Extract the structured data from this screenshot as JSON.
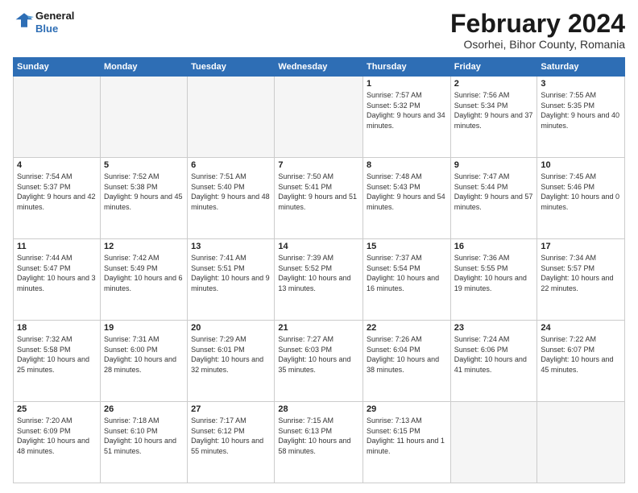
{
  "header": {
    "logo": {
      "line1": "General",
      "line2": "Blue"
    },
    "title": "February 2024",
    "location": "Osorhei, Bihor County, Romania"
  },
  "weekdays": [
    "Sunday",
    "Monday",
    "Tuesday",
    "Wednesday",
    "Thursday",
    "Friday",
    "Saturday"
  ],
  "weeks": [
    [
      {
        "day": "",
        "empty": true
      },
      {
        "day": "",
        "empty": true
      },
      {
        "day": "",
        "empty": true
      },
      {
        "day": "",
        "empty": true
      },
      {
        "day": "1",
        "sunrise": "7:57 AM",
        "sunset": "5:32 PM",
        "daylight": "9 hours and 34 minutes."
      },
      {
        "day": "2",
        "sunrise": "7:56 AM",
        "sunset": "5:34 PM",
        "daylight": "9 hours and 37 minutes."
      },
      {
        "day": "3",
        "sunrise": "7:55 AM",
        "sunset": "5:35 PM",
        "daylight": "9 hours and 40 minutes."
      }
    ],
    [
      {
        "day": "4",
        "sunrise": "7:54 AM",
        "sunset": "5:37 PM",
        "daylight": "9 hours and 42 minutes."
      },
      {
        "day": "5",
        "sunrise": "7:52 AM",
        "sunset": "5:38 PM",
        "daylight": "9 hours and 45 minutes."
      },
      {
        "day": "6",
        "sunrise": "7:51 AM",
        "sunset": "5:40 PM",
        "daylight": "9 hours and 48 minutes."
      },
      {
        "day": "7",
        "sunrise": "7:50 AM",
        "sunset": "5:41 PM",
        "daylight": "9 hours and 51 minutes."
      },
      {
        "day": "8",
        "sunrise": "7:48 AM",
        "sunset": "5:43 PM",
        "daylight": "9 hours and 54 minutes."
      },
      {
        "day": "9",
        "sunrise": "7:47 AM",
        "sunset": "5:44 PM",
        "daylight": "9 hours and 57 minutes."
      },
      {
        "day": "10",
        "sunrise": "7:45 AM",
        "sunset": "5:46 PM",
        "daylight": "10 hours and 0 minutes."
      }
    ],
    [
      {
        "day": "11",
        "sunrise": "7:44 AM",
        "sunset": "5:47 PM",
        "daylight": "10 hours and 3 minutes."
      },
      {
        "day": "12",
        "sunrise": "7:42 AM",
        "sunset": "5:49 PM",
        "daylight": "10 hours and 6 minutes."
      },
      {
        "day": "13",
        "sunrise": "7:41 AM",
        "sunset": "5:51 PM",
        "daylight": "10 hours and 9 minutes."
      },
      {
        "day": "14",
        "sunrise": "7:39 AM",
        "sunset": "5:52 PM",
        "daylight": "10 hours and 13 minutes."
      },
      {
        "day": "15",
        "sunrise": "7:37 AM",
        "sunset": "5:54 PM",
        "daylight": "10 hours and 16 minutes."
      },
      {
        "day": "16",
        "sunrise": "7:36 AM",
        "sunset": "5:55 PM",
        "daylight": "10 hours and 19 minutes."
      },
      {
        "day": "17",
        "sunrise": "7:34 AM",
        "sunset": "5:57 PM",
        "daylight": "10 hours and 22 minutes."
      }
    ],
    [
      {
        "day": "18",
        "sunrise": "7:32 AM",
        "sunset": "5:58 PM",
        "daylight": "10 hours and 25 minutes."
      },
      {
        "day": "19",
        "sunrise": "7:31 AM",
        "sunset": "6:00 PM",
        "daylight": "10 hours and 28 minutes."
      },
      {
        "day": "20",
        "sunrise": "7:29 AM",
        "sunset": "6:01 PM",
        "daylight": "10 hours and 32 minutes."
      },
      {
        "day": "21",
        "sunrise": "7:27 AM",
        "sunset": "6:03 PM",
        "daylight": "10 hours and 35 minutes."
      },
      {
        "day": "22",
        "sunrise": "7:26 AM",
        "sunset": "6:04 PM",
        "daylight": "10 hours and 38 minutes."
      },
      {
        "day": "23",
        "sunrise": "7:24 AM",
        "sunset": "6:06 PM",
        "daylight": "10 hours and 41 minutes."
      },
      {
        "day": "24",
        "sunrise": "7:22 AM",
        "sunset": "6:07 PM",
        "daylight": "10 hours and 45 minutes."
      }
    ],
    [
      {
        "day": "25",
        "sunrise": "7:20 AM",
        "sunset": "6:09 PM",
        "daylight": "10 hours and 48 minutes."
      },
      {
        "day": "26",
        "sunrise": "7:18 AM",
        "sunset": "6:10 PM",
        "daylight": "10 hours and 51 minutes."
      },
      {
        "day": "27",
        "sunrise": "7:17 AM",
        "sunset": "6:12 PM",
        "daylight": "10 hours and 55 minutes."
      },
      {
        "day": "28",
        "sunrise": "7:15 AM",
        "sunset": "6:13 PM",
        "daylight": "10 hours and 58 minutes."
      },
      {
        "day": "29",
        "sunrise": "7:13 AM",
        "sunset": "6:15 PM",
        "daylight": "11 hours and 1 minute."
      },
      {
        "day": "",
        "empty": true
      },
      {
        "day": "",
        "empty": true
      }
    ]
  ]
}
